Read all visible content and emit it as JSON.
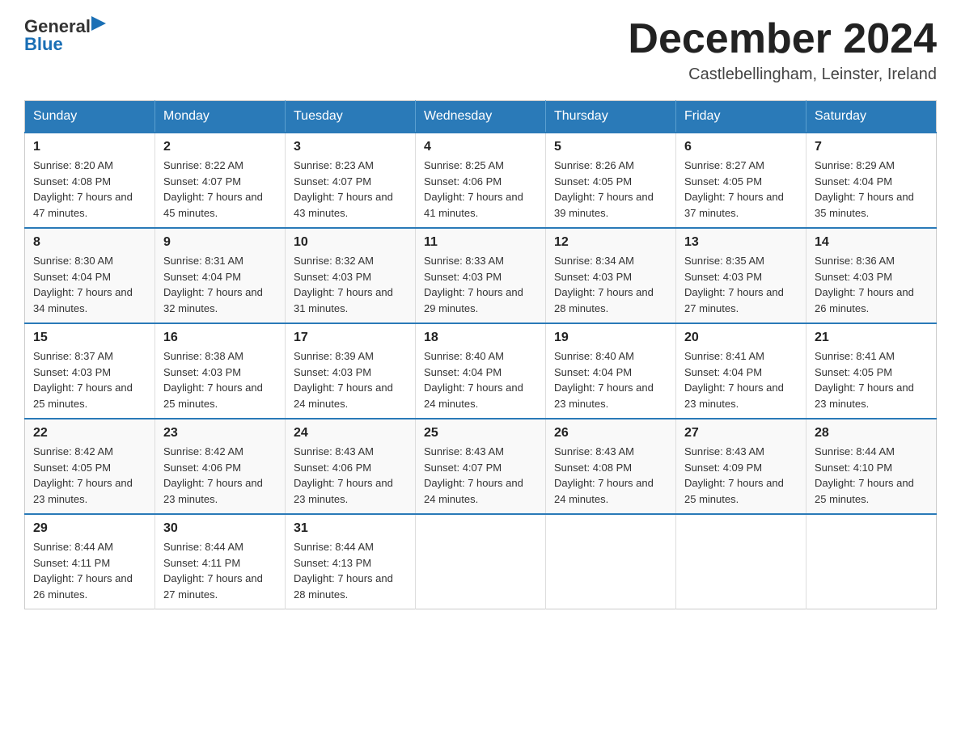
{
  "header": {
    "logo_general": "General",
    "logo_blue": "Blue",
    "month_title": "December 2024",
    "location": "Castlebellingham, Leinster, Ireland"
  },
  "days_of_week": [
    "Sunday",
    "Monday",
    "Tuesday",
    "Wednesday",
    "Thursday",
    "Friday",
    "Saturday"
  ],
  "weeks": [
    [
      {
        "day": "1",
        "sunrise": "8:20 AM",
        "sunset": "4:08 PM",
        "daylight": "7 hours and 47 minutes."
      },
      {
        "day": "2",
        "sunrise": "8:22 AM",
        "sunset": "4:07 PM",
        "daylight": "7 hours and 45 minutes."
      },
      {
        "day": "3",
        "sunrise": "8:23 AM",
        "sunset": "4:07 PM",
        "daylight": "7 hours and 43 minutes."
      },
      {
        "day": "4",
        "sunrise": "8:25 AM",
        "sunset": "4:06 PM",
        "daylight": "7 hours and 41 minutes."
      },
      {
        "day": "5",
        "sunrise": "8:26 AM",
        "sunset": "4:05 PM",
        "daylight": "7 hours and 39 minutes."
      },
      {
        "day": "6",
        "sunrise": "8:27 AM",
        "sunset": "4:05 PM",
        "daylight": "7 hours and 37 minutes."
      },
      {
        "day": "7",
        "sunrise": "8:29 AM",
        "sunset": "4:04 PM",
        "daylight": "7 hours and 35 minutes."
      }
    ],
    [
      {
        "day": "8",
        "sunrise": "8:30 AM",
        "sunset": "4:04 PM",
        "daylight": "7 hours and 34 minutes."
      },
      {
        "day": "9",
        "sunrise": "8:31 AM",
        "sunset": "4:04 PM",
        "daylight": "7 hours and 32 minutes."
      },
      {
        "day": "10",
        "sunrise": "8:32 AM",
        "sunset": "4:03 PM",
        "daylight": "7 hours and 31 minutes."
      },
      {
        "day": "11",
        "sunrise": "8:33 AM",
        "sunset": "4:03 PM",
        "daylight": "7 hours and 29 minutes."
      },
      {
        "day": "12",
        "sunrise": "8:34 AM",
        "sunset": "4:03 PM",
        "daylight": "7 hours and 28 minutes."
      },
      {
        "day": "13",
        "sunrise": "8:35 AM",
        "sunset": "4:03 PM",
        "daylight": "7 hours and 27 minutes."
      },
      {
        "day": "14",
        "sunrise": "8:36 AM",
        "sunset": "4:03 PM",
        "daylight": "7 hours and 26 minutes."
      }
    ],
    [
      {
        "day": "15",
        "sunrise": "8:37 AM",
        "sunset": "4:03 PM",
        "daylight": "7 hours and 25 minutes."
      },
      {
        "day": "16",
        "sunrise": "8:38 AM",
        "sunset": "4:03 PM",
        "daylight": "7 hours and 25 minutes."
      },
      {
        "day": "17",
        "sunrise": "8:39 AM",
        "sunset": "4:03 PM",
        "daylight": "7 hours and 24 minutes."
      },
      {
        "day": "18",
        "sunrise": "8:40 AM",
        "sunset": "4:04 PM",
        "daylight": "7 hours and 24 minutes."
      },
      {
        "day": "19",
        "sunrise": "8:40 AM",
        "sunset": "4:04 PM",
        "daylight": "7 hours and 23 minutes."
      },
      {
        "day": "20",
        "sunrise": "8:41 AM",
        "sunset": "4:04 PM",
        "daylight": "7 hours and 23 minutes."
      },
      {
        "day": "21",
        "sunrise": "8:41 AM",
        "sunset": "4:05 PM",
        "daylight": "7 hours and 23 minutes."
      }
    ],
    [
      {
        "day": "22",
        "sunrise": "8:42 AM",
        "sunset": "4:05 PM",
        "daylight": "7 hours and 23 minutes."
      },
      {
        "day": "23",
        "sunrise": "8:42 AM",
        "sunset": "4:06 PM",
        "daylight": "7 hours and 23 minutes."
      },
      {
        "day": "24",
        "sunrise": "8:43 AM",
        "sunset": "4:06 PM",
        "daylight": "7 hours and 23 minutes."
      },
      {
        "day": "25",
        "sunrise": "8:43 AM",
        "sunset": "4:07 PM",
        "daylight": "7 hours and 24 minutes."
      },
      {
        "day": "26",
        "sunrise": "8:43 AM",
        "sunset": "4:08 PM",
        "daylight": "7 hours and 24 minutes."
      },
      {
        "day": "27",
        "sunrise": "8:43 AM",
        "sunset": "4:09 PM",
        "daylight": "7 hours and 25 minutes."
      },
      {
        "day": "28",
        "sunrise": "8:44 AM",
        "sunset": "4:10 PM",
        "daylight": "7 hours and 25 minutes."
      }
    ],
    [
      {
        "day": "29",
        "sunrise": "8:44 AM",
        "sunset": "4:11 PM",
        "daylight": "7 hours and 26 minutes."
      },
      {
        "day": "30",
        "sunrise": "8:44 AM",
        "sunset": "4:11 PM",
        "daylight": "7 hours and 27 minutes."
      },
      {
        "day": "31",
        "sunrise": "8:44 AM",
        "sunset": "4:13 PM",
        "daylight": "7 hours and 28 minutes."
      },
      null,
      null,
      null,
      null
    ]
  ]
}
